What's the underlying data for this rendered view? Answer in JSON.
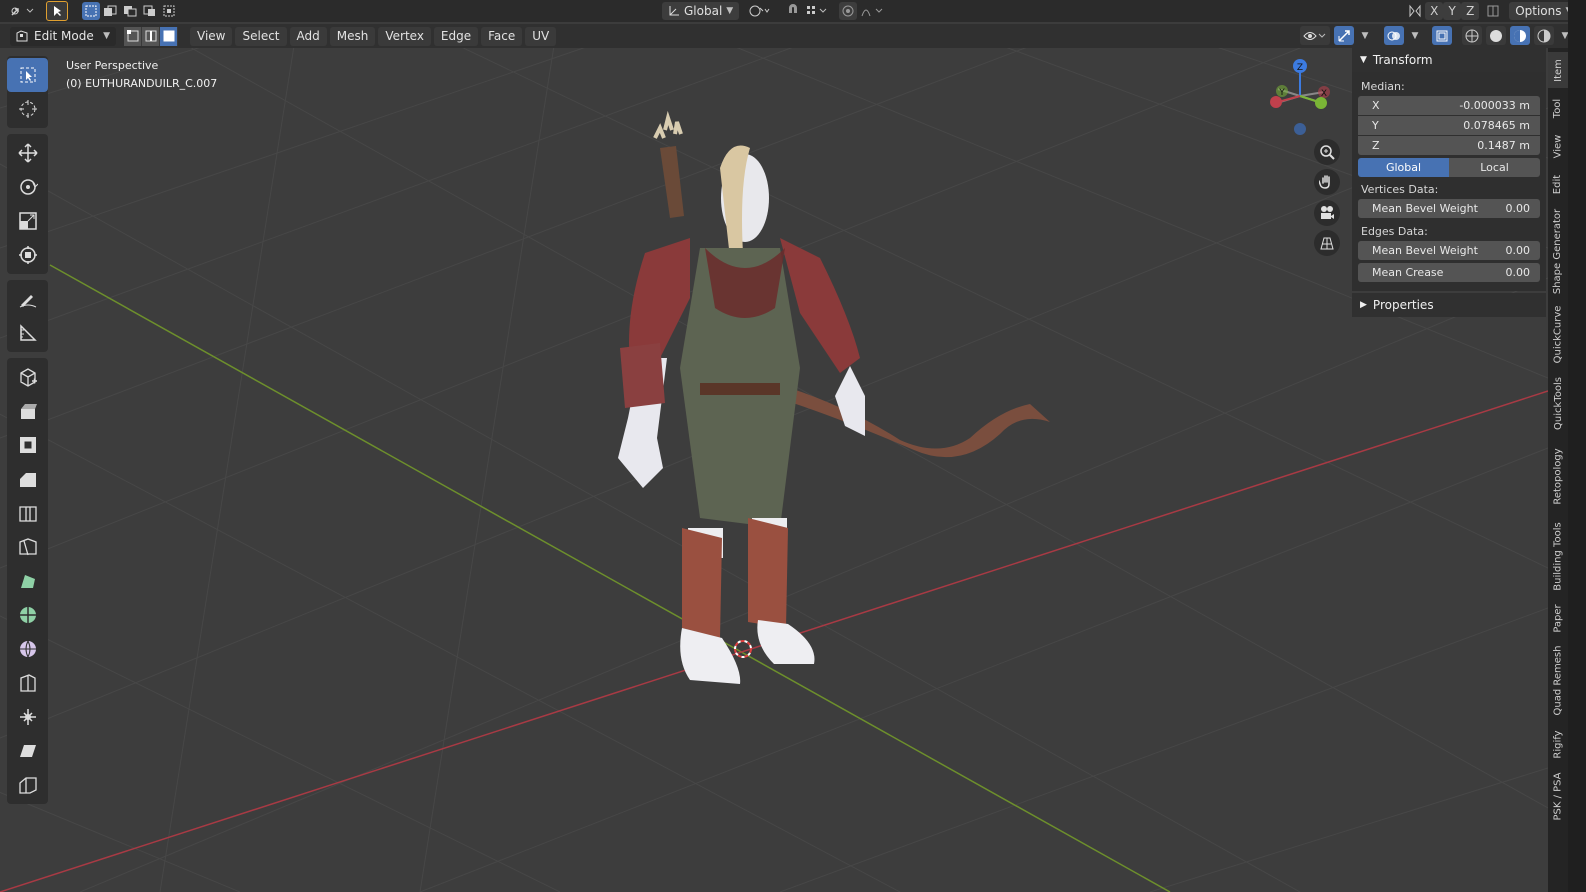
{
  "top_bar": {
    "transform_orientation": "Global",
    "axis_x": "X",
    "axis_y": "Y",
    "axis_z": "Z",
    "options": "Options"
  },
  "header": {
    "mode": "Edit Mode",
    "menus": [
      "View",
      "Select",
      "Add",
      "Mesh",
      "Vertex",
      "Edge",
      "Face",
      "UV"
    ]
  },
  "viewport": {
    "perspective": "User Perspective",
    "object": "(0) EUTHURANDUILR_C.007",
    "gizmo_labels": {
      "x": "X",
      "y": "Y",
      "z": "Z"
    }
  },
  "toolbar": {
    "tools": [
      "select-box-icon",
      "cursor-icon",
      "move-icon",
      "rotate-icon",
      "scale-icon",
      "transform-icon",
      "annotate-icon",
      "measure-icon",
      "add-cube-icon",
      "extrude-icon",
      "inset-icon",
      "bevel-icon",
      "loop-cut-icon",
      "knife-icon",
      "poly-build-icon",
      "spin-icon",
      "smooth-icon",
      "edge-slide-icon",
      "shrink-fatten-icon",
      "shear-icon",
      "rip-icon"
    ]
  },
  "sidebar": {
    "transform_title": "Transform",
    "median_label": "Median:",
    "x_label": "X",
    "x_value": "-0.000033 m",
    "y_label": "Y",
    "y_value": "0.078465 m",
    "z_label": "Z",
    "z_value": "0.1487 m",
    "global_label": "Global",
    "local_label": "Local",
    "vertices_data_label": "Vertices Data:",
    "vertex_bevel_label": "Mean Bevel Weight",
    "vertex_bevel_value": "0.00",
    "edges_data_label": "Edges Data:",
    "edge_bevel_label": "Mean Bevel Weight",
    "edge_bevel_value": "0.00",
    "crease_label": "Mean Crease",
    "crease_value": "0.00",
    "properties_title": "Properties"
  },
  "tabs": [
    "Item",
    "Tool",
    "View",
    "Edit",
    "Shape Generator",
    "QuickCurve",
    "QuickTools",
    "Retopology",
    "Building Tools",
    "Paper",
    "Quad Remesh",
    "Rigify",
    "PSK / PSA"
  ],
  "colors": {
    "accent": "#4772b3",
    "x_axis": "#c0404c",
    "y_axis": "#7ab536",
    "z_axis": "#3c7be0"
  }
}
